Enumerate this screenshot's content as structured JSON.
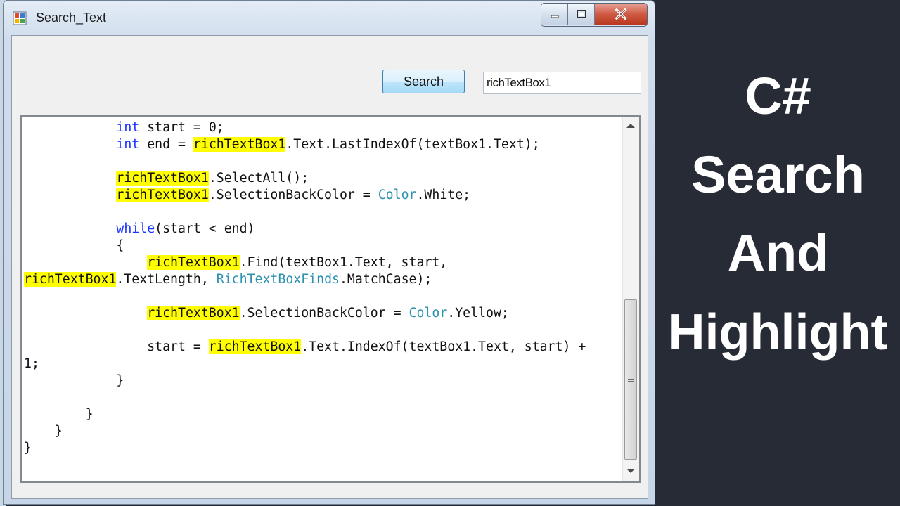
{
  "window": {
    "title": "Search_Text"
  },
  "toolbar": {
    "search_button_label": "Search",
    "search_input_value": "richTextBox1"
  },
  "editor": {
    "lines": [
      [
        {
          "t": "            "
        },
        {
          "t": "int",
          "c": "kw"
        },
        {
          "t": " start = 0;"
        }
      ],
      [
        {
          "t": "            "
        },
        {
          "t": "int",
          "c": "kw"
        },
        {
          "t": " end = "
        },
        {
          "t": "richTextBox1",
          "c": "hl"
        },
        {
          "t": ".Text.LastIndexOf(textBox1.Text);"
        }
      ],
      [],
      [
        {
          "t": "            "
        },
        {
          "t": "richTextBox1",
          "c": "hl"
        },
        {
          "t": ".SelectAll();"
        }
      ],
      [
        {
          "t": "            "
        },
        {
          "t": "richTextBox1",
          "c": "hl"
        },
        {
          "t": ".SelectionBackColor = "
        },
        {
          "t": "Color",
          "c": "ty"
        },
        {
          "t": ".White;"
        }
      ],
      [],
      [
        {
          "t": "            "
        },
        {
          "t": "while",
          "c": "kw"
        },
        {
          "t": "(start < end)"
        }
      ],
      [
        {
          "t": "            {"
        }
      ],
      [
        {
          "t": "                "
        },
        {
          "t": "richTextBox1",
          "c": "hl"
        },
        {
          "t": ".Find(textBox1.Text, start,"
        }
      ],
      [
        {
          "t": "richTextBox1",
          "c": "hl"
        },
        {
          "t": ".TextLength, "
        },
        {
          "t": "RichTextBoxFinds",
          "c": "ty"
        },
        {
          "t": ".MatchCase);"
        }
      ],
      [],
      [
        {
          "t": "                "
        },
        {
          "t": "richTextBox1",
          "c": "hl"
        },
        {
          "t": ".SelectionBackColor = "
        },
        {
          "t": "Color",
          "c": "ty"
        },
        {
          "t": ".Yellow;"
        }
      ],
      [],
      [
        {
          "t": "                start = "
        },
        {
          "t": "richTextBox1",
          "c": "hl"
        },
        {
          "t": ".Text.IndexOf(textBox1.Text, start) +"
        }
      ],
      [
        {
          "t": "1;"
        }
      ],
      [
        {
          "t": "            }"
        }
      ],
      [],
      [
        {
          "t": "        }"
        }
      ],
      [
        {
          "t": "    }"
        }
      ],
      [
        {
          "t": "}"
        }
      ]
    ]
  },
  "promo": {
    "lines": [
      "C#",
      "Search",
      "And",
      "Highlight"
    ]
  },
  "colors": {
    "highlight": "#ffff00",
    "keyword": "#1a35ff",
    "type": "#2b91af",
    "promo_bg": "#262b36"
  }
}
